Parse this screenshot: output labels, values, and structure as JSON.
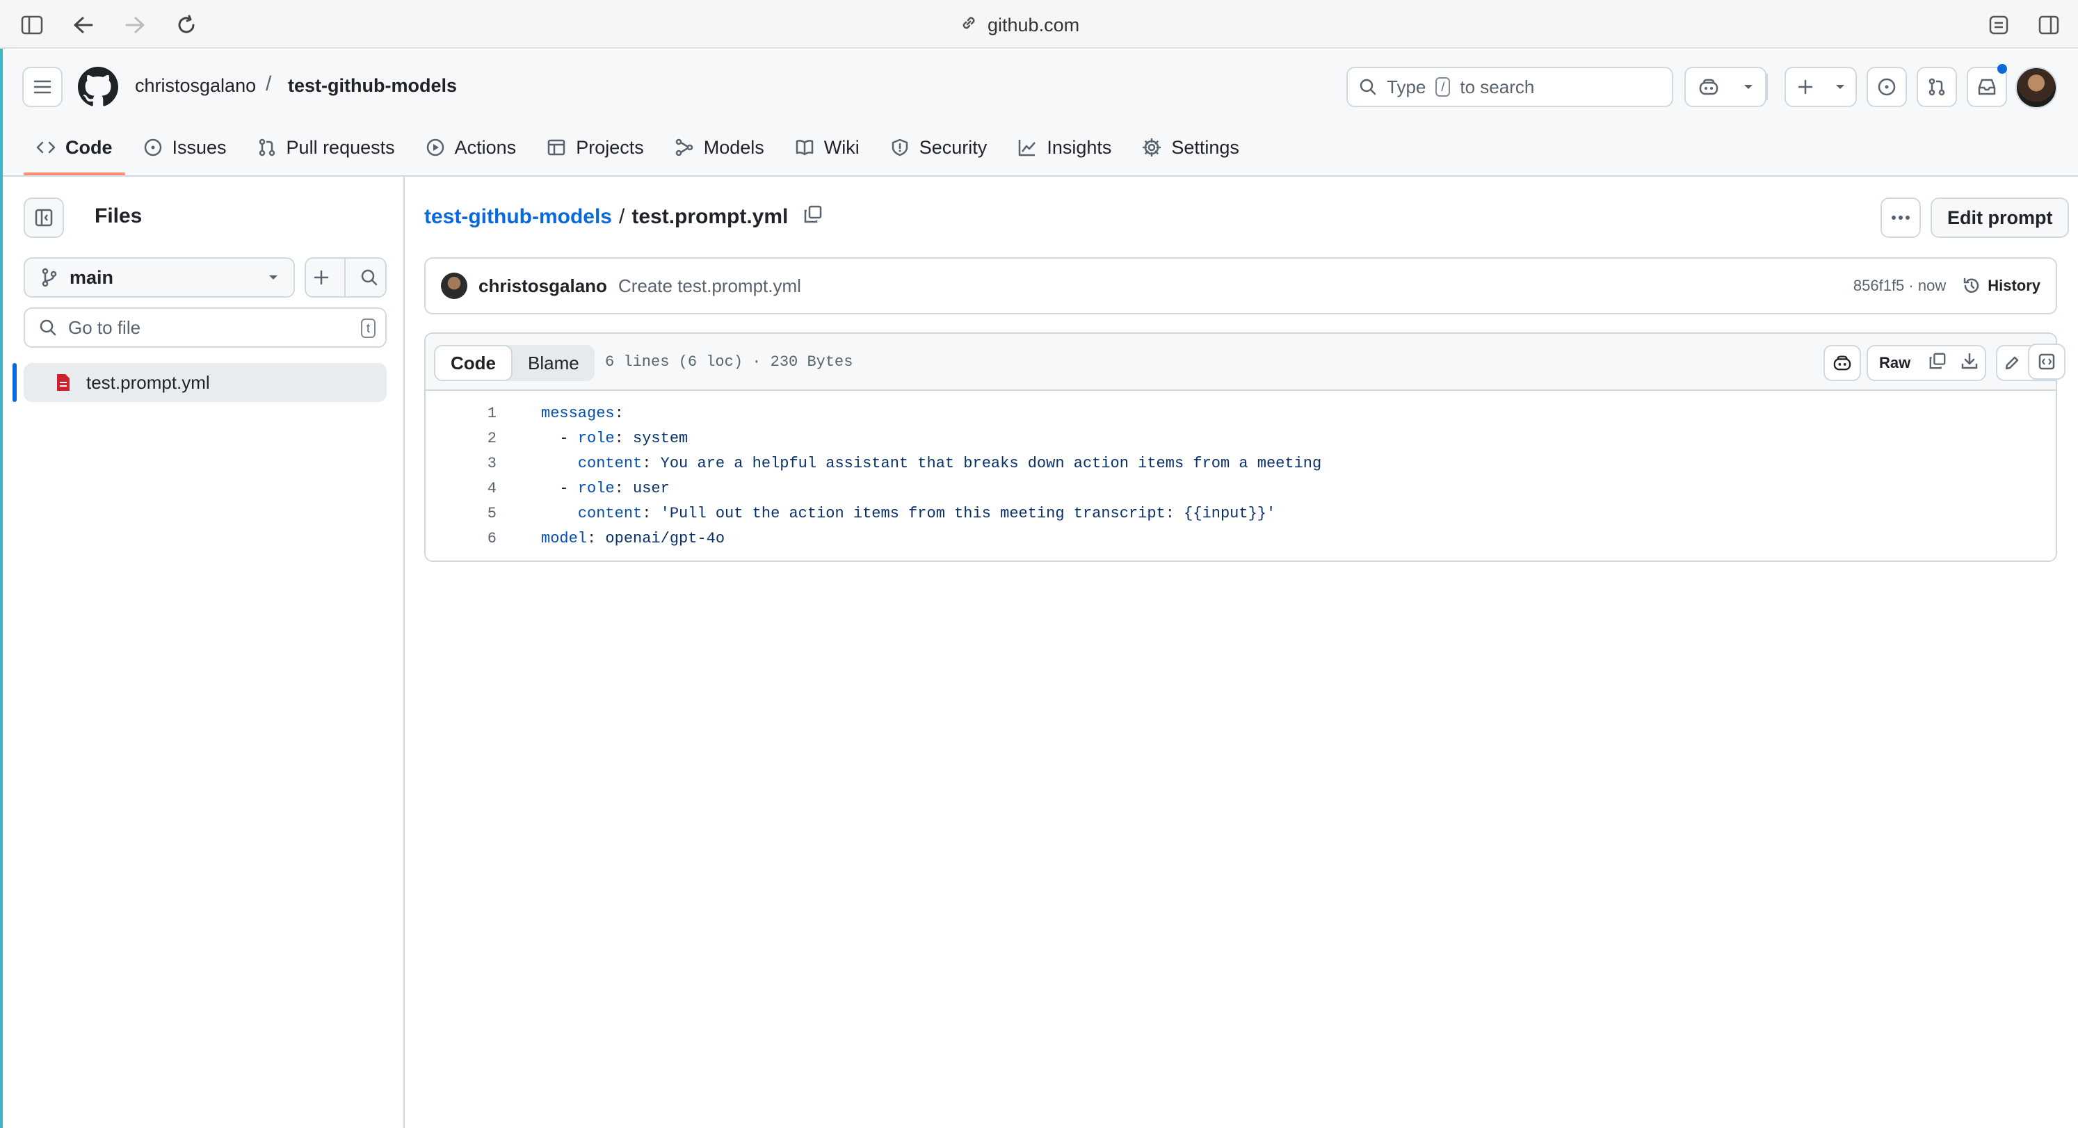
{
  "browser": {
    "url": "github.com"
  },
  "header": {
    "owner": "christosgalano",
    "separator": "/",
    "repo": "test-github-models",
    "search": {
      "prefix": "Type",
      "key": "/",
      "suffix": "to search"
    }
  },
  "tabs": [
    {
      "label": "Code",
      "icon": "code-icon"
    },
    {
      "label": "Issues",
      "icon": "issue-icon"
    },
    {
      "label": "Pull requests",
      "icon": "pull-request-icon"
    },
    {
      "label": "Actions",
      "icon": "play-icon"
    },
    {
      "label": "Projects",
      "icon": "table-icon"
    },
    {
      "label": "Models",
      "icon": "models-icon"
    },
    {
      "label": "Wiki",
      "icon": "book-icon"
    },
    {
      "label": "Security",
      "icon": "shield-icon"
    },
    {
      "label": "Insights",
      "icon": "graph-icon"
    },
    {
      "label": "Settings",
      "icon": "gear-icon"
    }
  ],
  "sidebar": {
    "title": "Files",
    "branch": "main",
    "goto_placeholder": "Go to file",
    "goto_key": "t",
    "files": [
      {
        "name": "test.prompt.yml"
      }
    ]
  },
  "file": {
    "repo_link": "test-github-models",
    "sep": "/",
    "name": "test.prompt.yml",
    "edit_label": "Edit prompt",
    "commit": {
      "author": "christosgalano",
      "message": "Create test.prompt.yml",
      "sha_time": "856f1f5 · now",
      "history_label": "History"
    },
    "view_code": "Code",
    "view_blame": "Blame",
    "meta": "6 lines (6 loc) · 230 Bytes",
    "raw_label": "Raw",
    "lines": [
      {
        "n": "1",
        "indent": "",
        "key": "messages",
        "value": ""
      },
      {
        "n": "2",
        "indent": "  - ",
        "key": "role",
        "value": " system"
      },
      {
        "n": "3",
        "indent": "    ",
        "key": "content",
        "value": " You are a helpful assistant that breaks down action items from a meeting"
      },
      {
        "n": "4",
        "indent": "  - ",
        "key": "role",
        "value": " user"
      },
      {
        "n": "5",
        "indent": "    ",
        "key": "content",
        "value": " 'Pull out the action items from this meeting transcript: {{input}}'"
      },
      {
        "n": "6",
        "indent": "",
        "key": "model",
        "value": " openai/gpt-4o"
      }
    ]
  },
  "colors": {
    "accent": "#0969da",
    "tab_underline": "#fd8c73",
    "file_icon": "#cf222e"
  }
}
